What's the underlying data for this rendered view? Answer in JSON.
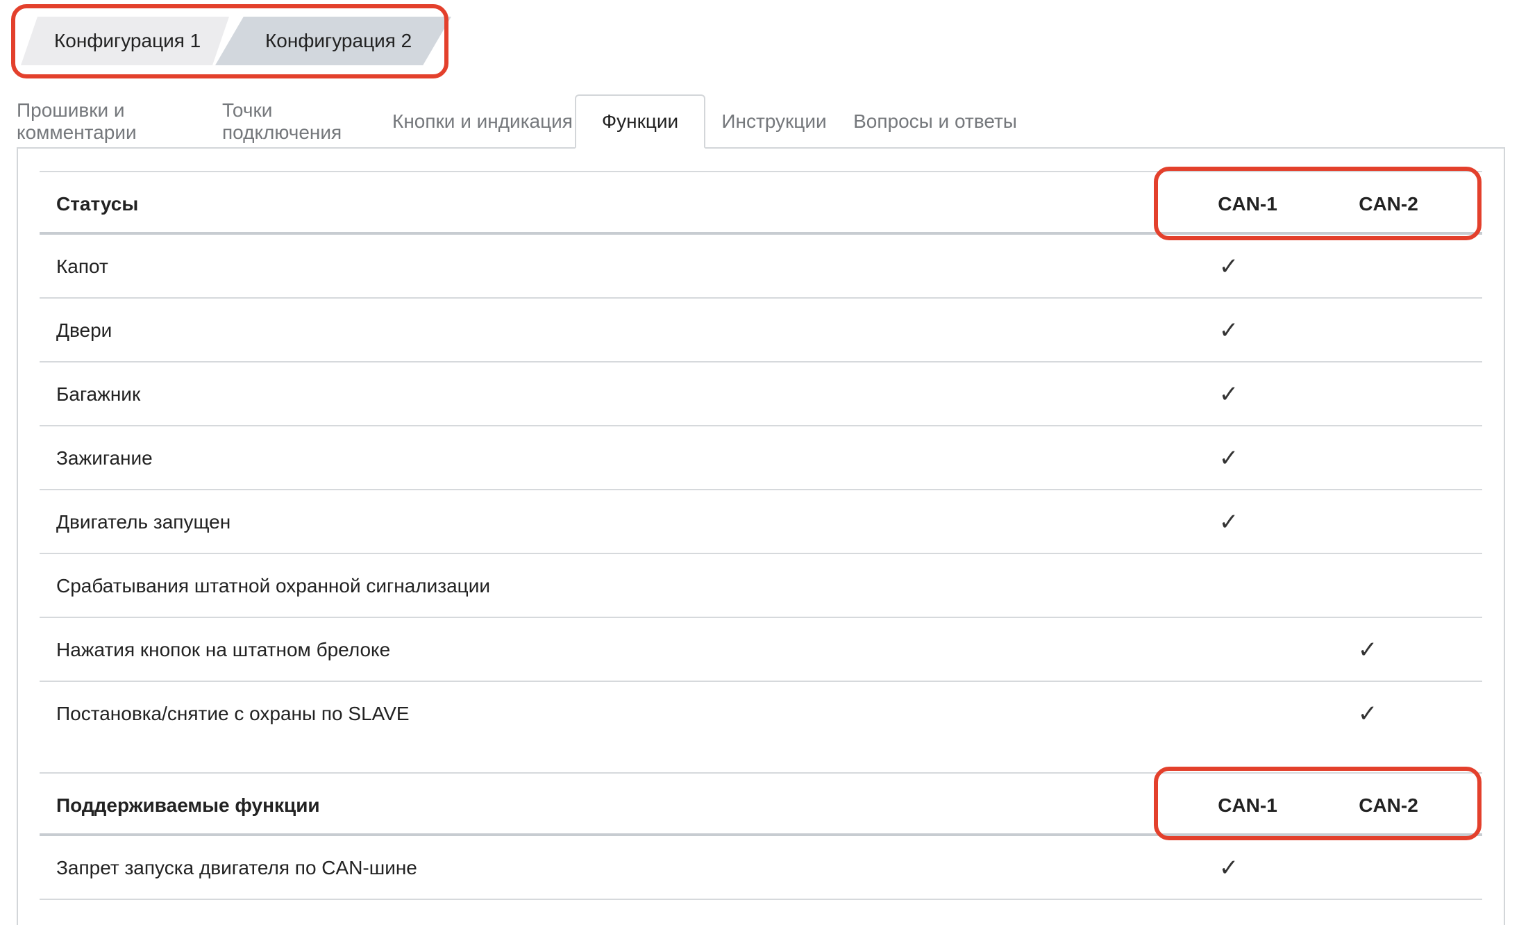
{
  "config_tabs": [
    "Конфигурация 1",
    "Конфигурация 2"
  ],
  "tabs": [
    "Прошивки и комментарии",
    "Точки подключения",
    "Кнопки и индикация",
    "Функции",
    "Инструкции",
    "Вопросы и ответы"
  ],
  "active_tab": "Функции",
  "check_glyph": "✓",
  "highlight_color": "#e3402c",
  "statuses": {
    "title": "Статусы",
    "col1": "CAN-1",
    "col2": "CAN-2",
    "rows": [
      {
        "label": "Капот",
        "can1": true,
        "can2": false
      },
      {
        "label": "Двери",
        "can1": true,
        "can2": false
      },
      {
        "label": "Багажник",
        "can1": true,
        "can2": false
      },
      {
        "label": "Зажигание",
        "can1": true,
        "can2": false
      },
      {
        "label": "Двигатель запущен",
        "can1": true,
        "can2": false
      },
      {
        "label": "Срабатывания штатной охранной сигнализации",
        "can1": false,
        "can2": false
      },
      {
        "label": "Нажатия кнопок на штатном брелоке",
        "can1": false,
        "can2": true
      },
      {
        "label": "Постановка/снятие с охраны по SLAVE",
        "can1": false,
        "can2": true
      }
    ]
  },
  "functions": {
    "title": "Поддерживаемые функции",
    "col1": "CAN-1",
    "col2": "CAN-2",
    "rows": [
      {
        "label": "Запрет запуска двигателя по CAN-шине",
        "can1": true,
        "can2": false
      }
    ]
  }
}
